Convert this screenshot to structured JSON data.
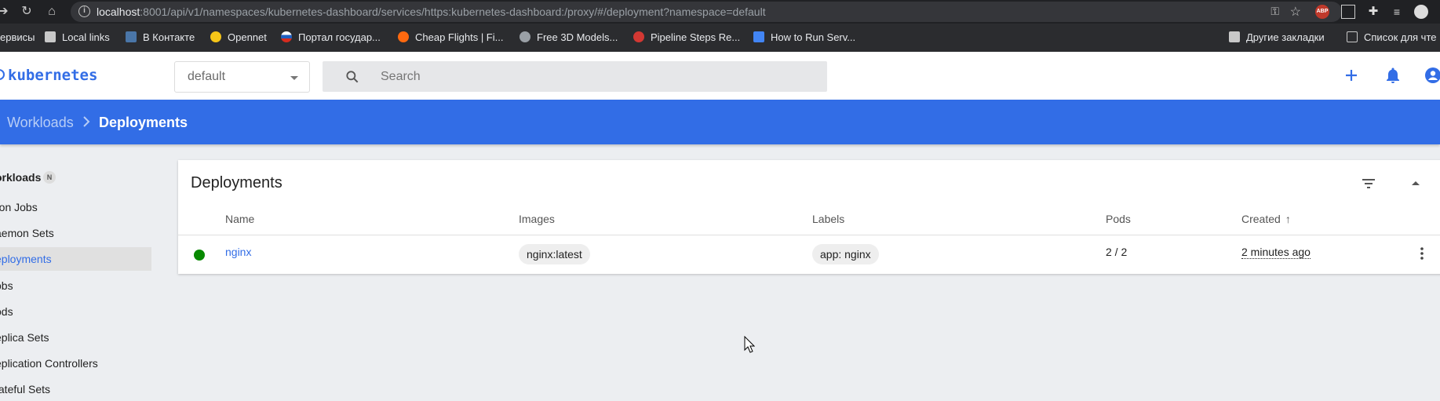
{
  "browser": {
    "url_host": "localhost",
    "url_rest": ":8001/api/v1/namespaces/kubernetes-dashboard/services/https:kubernetes-dashboard:/proxy/#/deployment?namespace=default",
    "bookmarks": [
      {
        "label": "ервисы",
        "icon": "apps-icon",
        "color": "#4285f4"
      },
      {
        "label": "Local links",
        "icon": "folder-icon",
        "color": "#c8c8c8"
      },
      {
        "label": "В Контакте",
        "icon": "vk-icon",
        "color": "#4a76a8"
      },
      {
        "label": "Opennet",
        "icon": "star-icon",
        "color": "#f5c518"
      },
      {
        "label": "Портал государ...",
        "icon": "flag-icon",
        "color": "#1f5fbf"
      },
      {
        "label": "Cheap Flights | Fi...",
        "icon": "kayak-icon",
        "color": "#ff690f"
      },
      {
        "label": "Free 3D Models...",
        "icon": "globe-icon",
        "color": "#9aa0a6"
      },
      {
        "label": "Pipeline Steps Re...",
        "icon": "jenkins-icon",
        "color": "#d33833"
      },
      {
        "label": "How to Run Serv...",
        "icon": "link-icon",
        "color": "#4285f4"
      }
    ],
    "other_bookmarks": "Другие закладки",
    "reading_list": "Список для чте"
  },
  "header": {
    "logo": "kubernetes",
    "namespace": "default",
    "search_placeholder": "Search"
  },
  "breadcrumb": {
    "parent": "Workloads",
    "current": "Deployments"
  },
  "sidebar": {
    "section": "orkloads",
    "badge": "N",
    "items": [
      {
        "label": "ron Jobs"
      },
      {
        "label": "aemon Sets"
      },
      {
        "label": "eployments"
      },
      {
        "label": "obs"
      },
      {
        "label": "ods"
      },
      {
        "label": "eplica Sets"
      },
      {
        "label": "eplication Controllers"
      },
      {
        "label": "tateful Sets"
      }
    ]
  },
  "deployments": {
    "title": "Deployments",
    "columns": {
      "name": "Name",
      "images": "Images",
      "labels": "Labels",
      "pods": "Pods",
      "created": "Created"
    },
    "rows": [
      {
        "name": "nginx",
        "image": "nginx:latest",
        "label": "app: nginx",
        "pods": "2 / 2",
        "created": "2 minutes ago",
        "status_color": "#078900"
      }
    ]
  },
  "colors": {
    "accent": "#326de6",
    "status_running": "#078900"
  }
}
